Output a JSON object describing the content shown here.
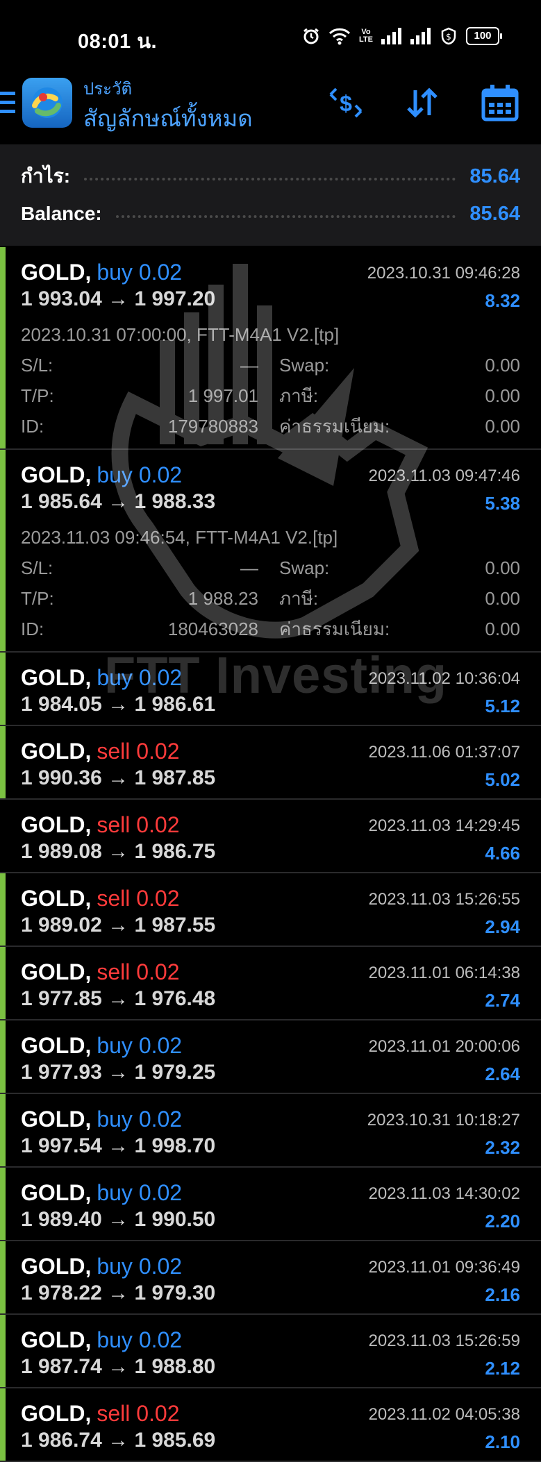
{
  "status_bar": {
    "time": "08:01 น.",
    "volte": "Vo\nLTE",
    "battery": "100"
  },
  "header": {
    "subtitle": "ประวัติ",
    "title": "สัญลักษณ์ทั้งหมด",
    "icons": [
      "menu-icon",
      "app-logo-icon",
      "currency-filter-icon",
      "sort-icon",
      "calendar-icon"
    ]
  },
  "summary": {
    "profit_label": "กำไร:",
    "profit_value": "85.64",
    "balance_label": "Balance:",
    "balance_value": "85.64"
  },
  "watermark": {
    "text": "FTT Investing"
  },
  "deals": [
    {
      "symbol": "GOLD,",
      "type": "buy 0.02",
      "side": "buy",
      "prices": "1 993.04 → 1 997.20",
      "time": "2023.10.31 09:46:28",
      "profit": "8.32",
      "marked": true,
      "expanded": true,
      "comment": "2023.10.31 07:00:00, FTT-M4A1 V2.[tp]",
      "rows": [
        {
          "l1": "S/L:",
          "v1": "—",
          "l2": "Swap:",
          "v2": "0.00"
        },
        {
          "l1": "T/P:",
          "v1": "1 997.01",
          "l2": "ภาษี:",
          "v2": "0.00"
        },
        {
          "l1": "ID:",
          "v1": "179780883",
          "l2": "ค่าธรรมเนียม:",
          "v2": "0.00"
        }
      ]
    },
    {
      "symbol": "GOLD,",
      "type": "buy 0.02",
      "side": "buy",
      "prices": "1 985.64 → 1 988.33",
      "time": "2023.11.03 09:47:46",
      "profit": "5.38",
      "marked": true,
      "expanded": true,
      "comment": "2023.11.03 09:46:54, FTT-M4A1 V2.[tp]",
      "rows": [
        {
          "l1": "S/L:",
          "v1": "—",
          "l2": "Swap:",
          "v2": "0.00"
        },
        {
          "l1": "T/P:",
          "v1": "1 988.23",
          "l2": "ภาษี:",
          "v2": "0.00"
        },
        {
          "l1": "ID:",
          "v1": "180463028",
          "l2": "ค่าธรรมเนียม:",
          "v2": "0.00"
        }
      ]
    },
    {
      "symbol": "GOLD,",
      "type": "buy 0.02",
      "side": "buy",
      "prices": "1 984.05 → 1 986.61",
      "time": "2023.11.02 10:36:04",
      "profit": "5.12",
      "marked": true
    },
    {
      "symbol": "GOLD,",
      "type": "sell 0.02",
      "side": "sell",
      "prices": "1 990.36 → 1 987.85",
      "time": "2023.11.06 01:37:07",
      "profit": "5.02",
      "marked": true
    },
    {
      "symbol": "GOLD,",
      "type": "sell 0.02",
      "side": "sell",
      "prices": "1 989.08 → 1 986.75",
      "time": "2023.11.03 14:29:45",
      "profit": "4.66",
      "marked": false
    },
    {
      "symbol": "GOLD,",
      "type": "sell 0.02",
      "side": "sell",
      "prices": "1 989.02 → 1 987.55",
      "time": "2023.11.03 15:26:55",
      "profit": "2.94",
      "marked": true
    },
    {
      "symbol": "GOLD,",
      "type": "sell 0.02",
      "side": "sell",
      "prices": "1 977.85 → 1 976.48",
      "time": "2023.11.01 06:14:38",
      "profit": "2.74",
      "marked": true
    },
    {
      "symbol": "GOLD,",
      "type": "buy 0.02",
      "side": "buy",
      "prices": "1 977.93 → 1 979.25",
      "time": "2023.11.01 20:00:06",
      "profit": "2.64",
      "marked": true
    },
    {
      "symbol": "GOLD,",
      "type": "buy 0.02",
      "side": "buy",
      "prices": "1 997.54 → 1 998.70",
      "time": "2023.10.31 10:18:27",
      "profit": "2.32",
      "marked": true
    },
    {
      "symbol": "GOLD,",
      "type": "buy 0.02",
      "side": "buy",
      "prices": "1 989.40 → 1 990.50",
      "time": "2023.11.03 14:30:02",
      "profit": "2.20",
      "marked": true
    },
    {
      "symbol": "GOLD,",
      "type": "buy 0.02",
      "side": "buy",
      "prices": "1 978.22 → 1 979.30",
      "time": "2023.11.01 09:36:49",
      "profit": "2.16",
      "marked": true
    },
    {
      "symbol": "GOLD,",
      "type": "buy 0.02",
      "side": "buy",
      "prices": "1 987.74 → 1 988.80",
      "time": "2023.11.03 15:26:59",
      "profit": "2.12",
      "marked": true
    },
    {
      "symbol": "GOLD,",
      "type": "sell 0.02",
      "side": "sell",
      "prices": "1 986.74 → 1 985.69",
      "time": "2023.11.02 04:05:38",
      "profit": "2.10",
      "marked": true
    }
  ]
}
